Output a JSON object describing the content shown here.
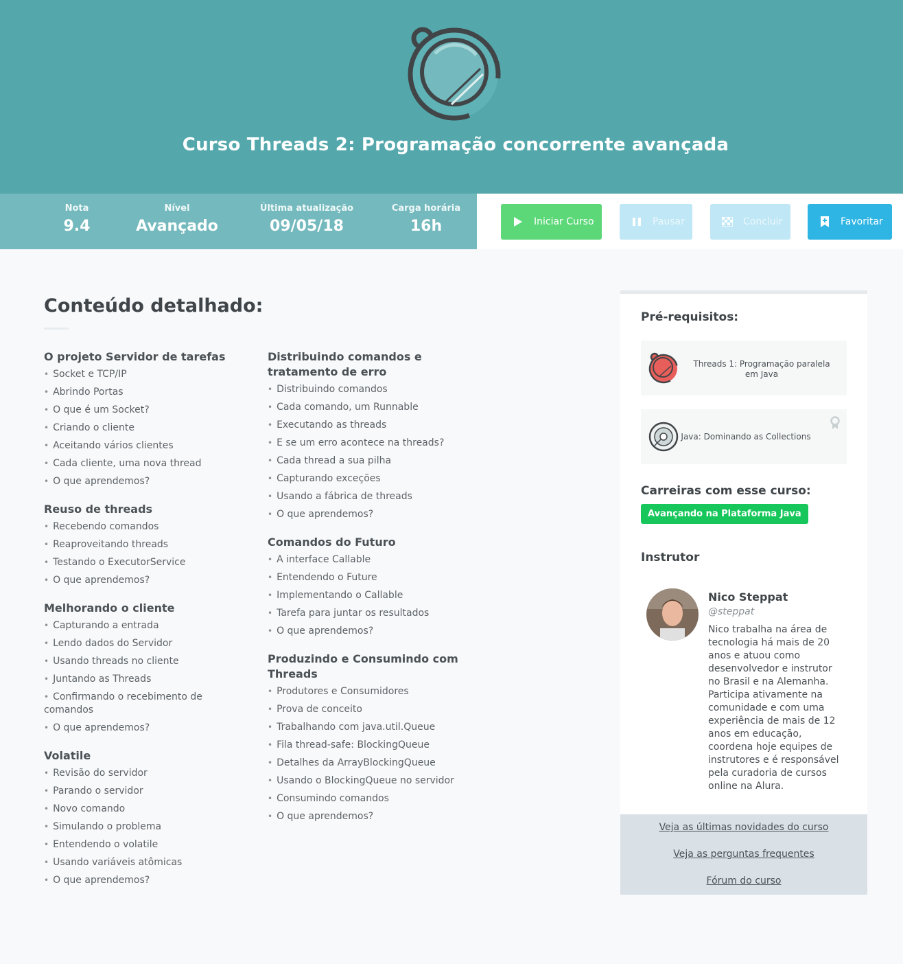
{
  "course": {
    "title": "Curso Threads 2: Programação concorrente avançada",
    "logo_icon": "clock-badge-icon"
  },
  "stats": [
    {
      "label": "Nota",
      "value": "9.4"
    },
    {
      "label": "Nível",
      "value": "Avançado"
    },
    {
      "label": "Última atualização",
      "value": "09/05/18"
    },
    {
      "label": "Carga horária",
      "value": "16h"
    }
  ],
  "actions": {
    "start": "Iniciar Curso",
    "pause": "Pausar",
    "finish": "Concluir",
    "favorite": "Favoritar"
  },
  "colors": {
    "hero": "#54a8ac",
    "stats_bar": "#74b9bd",
    "start_btn": "#5dd879",
    "disabled_btn": "#c0e7f5",
    "favorite_btn": "#2fb5e3",
    "career_tag": "#17c75b"
  },
  "content": {
    "title": "Conteúdo detalhado:",
    "col_a": [
      {
        "title": "O projeto Servidor de tarefas",
        "items": [
          "Socket e TCP/IP",
          "Abrindo Portas",
          "O que é um Socket?",
          "Criando o cliente",
          "Aceitando vários clientes",
          "Cada cliente, uma nova thread",
          "O que aprendemos?"
        ]
      },
      {
        "title": "Reuso de threads",
        "items": [
          "Recebendo comandos",
          "Reaproveitando threads",
          "Testando o ExecutorService",
          "O que aprendemos?"
        ]
      },
      {
        "title": "Melhorando o cliente",
        "items": [
          "Capturando a entrada",
          "Lendo dados do Servidor",
          "Usando threads no cliente",
          "Juntando as Threads",
          "Confirmando o recebimento de comandos",
          "O que aprendemos?"
        ]
      },
      {
        "title": "Volatile",
        "items": [
          "Revisão do servidor",
          "Parando o servidor",
          "Novo comando",
          "Simulando o problema",
          "Entendendo o volatile",
          "Usando variáveis atômicas",
          "O que aprendemos?"
        ]
      }
    ],
    "col_b": [
      {
        "title": "Distribuindo comandos e tratamento de erro",
        "items": [
          "Distribuindo comandos",
          "Cada comando, um Runnable",
          "Executando as threads",
          "E se um erro acontece na threads?",
          "Cada thread a sua pilha",
          "Capturando exceções",
          "Usando a fábrica de threads",
          "O que aprendemos?"
        ]
      },
      {
        "title": "Comandos do Futuro",
        "items": [
          "A interface Callable",
          "Entendendo o Future",
          "Implementando o Callable",
          "Tarefa para juntar os resultados",
          "O que aprendemos?"
        ]
      },
      {
        "title": "Produzindo e Consumindo com Threads",
        "items": [
          "Produtores e Consumidores",
          "Prova de conceito",
          "Trabalhando com java.util.Queue",
          "Fila thread-safe: BlockingQueue",
          "Detalhes da ArrayBlockingQueue",
          "Usando o BlockingQueue no servidor",
          "Consumindo comandos",
          "O que aprendemos?"
        ]
      }
    ]
  },
  "sidebar": {
    "prereq_title": "Pré-requisitos:",
    "prereqs": [
      {
        "name": "Threads 1: Programação paralela em Java",
        "icon": "threads-clock-icon"
      },
      {
        "name": "Java: Dominando as Collections",
        "icon": "collections-disc-icon",
        "badge_icon": "certificate-badge-icon"
      }
    ],
    "careers_title": "Carreiras com esse curso:",
    "career": "Avançando na Plataforma Java",
    "instructor_title": "Instrutor",
    "instructor": {
      "name": "Nico Steppat",
      "handle": "@steppat",
      "bio": "Nico trabalha na área de tecnologia há mais de 20 anos e atuou como desenvolvedor e instrutor no Brasil e na Alemanha. Participa ativamente na comunidade e com uma experiência de mais de 12 anos em educação, coordena hoje equipes de instrutores e é responsável pela curadoria de cursos online na Alura."
    },
    "links": [
      "Veja as últimas novidades do curso",
      "Veja as perguntas frequentes",
      "Fórum do curso"
    ]
  }
}
